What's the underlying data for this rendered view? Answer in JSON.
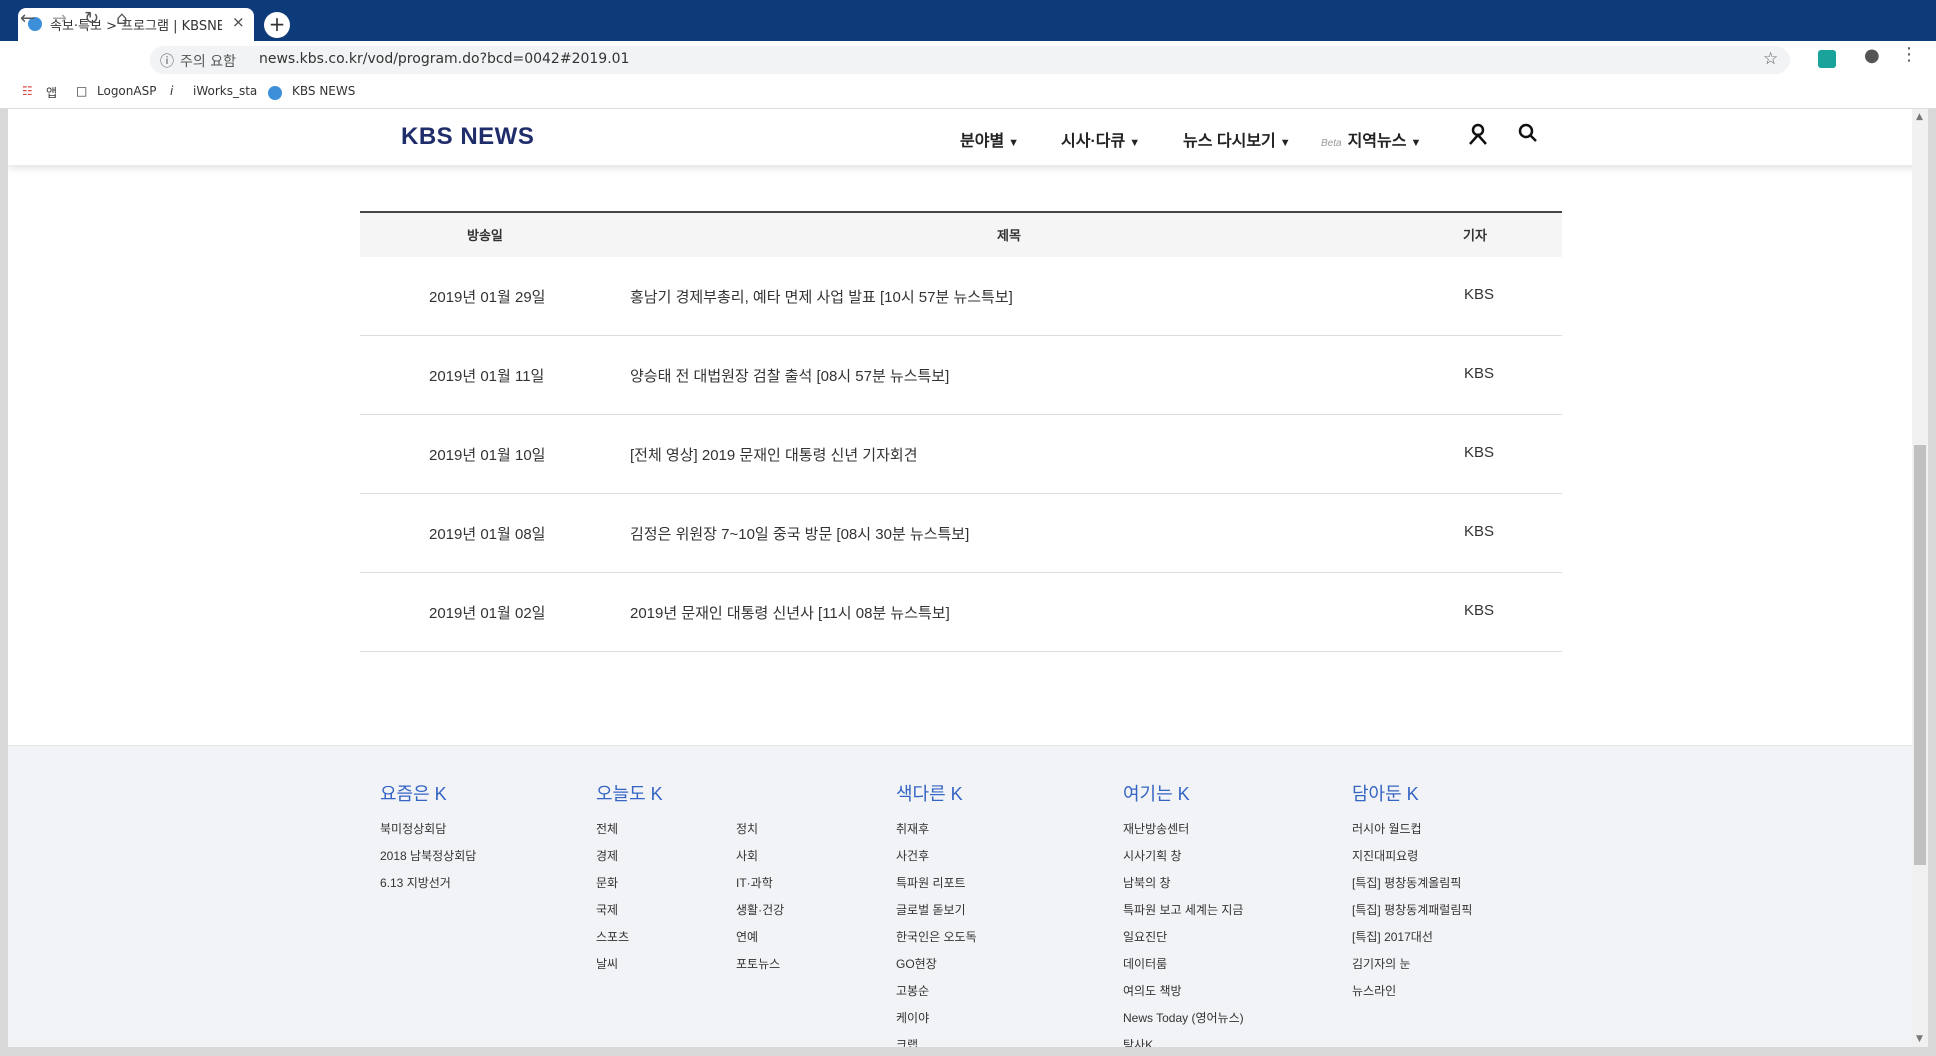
{
  "browser": {
    "tab_title": "속보·특보 > 프로그램 | KBSNEWS",
    "tab_close": "×",
    "new_tab": "+",
    "security_label": "주의 요함",
    "url": "news.kbs.co.kr/vod/program.do?bcd=0042#2019.01",
    "bookmarks": [
      "앱",
      "LogonASP",
      "iWorks_sta",
      "KBS NEWS"
    ]
  },
  "header": {
    "logo": "KBS NEWS",
    "nav": [
      {
        "label": "분야별"
      },
      {
        "label": "시사·다큐"
      },
      {
        "label": "뉴스 다시보기"
      },
      {
        "label": "지역뉴스",
        "badge": "Beta"
      }
    ]
  },
  "table": {
    "columns": [
      "방송일",
      "제목",
      "기자"
    ],
    "rows": [
      {
        "date": "2019년 01월 29일",
        "title": "홍남기 경제부총리, 예타 면제 사업 발표 [10시 57분 뉴스특보]",
        "reporter": "KBS"
      },
      {
        "date": "2019년 01월 11일",
        "title": "양승태 전 대법원장 검찰 출석 [08시 57분 뉴스특보]",
        "reporter": "KBS"
      },
      {
        "date": "2019년 01월 10일",
        "title": "[전체 영상] 2019 문재인 대통령 신년 기자회견",
        "reporter": "KBS"
      },
      {
        "date": "2019년 01월 08일",
        "title": "김정은 위원장 7~10일 중국 방문 [08시 30분 뉴스특보]",
        "reporter": "KBS"
      },
      {
        "date": "2019년 01월 02일",
        "title": "2019년 문재인 대통령 신년사 [11시 08분 뉴스특보]",
        "reporter": "KBS"
      }
    ]
  },
  "footer": {
    "sections": [
      {
        "title": "요즘은 K",
        "links": [
          "북미정상회담",
          "2018 남북정상회담",
          "6.13 지방선거"
        ]
      },
      {
        "title": "오늘도 K",
        "links": [
          "전체",
          "경제",
          "문화",
          "국제",
          "스포츠",
          "날씨"
        ],
        "links2": [
          "정치",
          "사회",
          "IT·과학",
          "생활·건강",
          "연예",
          "포토뉴스"
        ]
      },
      {
        "title": "색다른 K",
        "links": [
          "취재후",
          "사건후",
          "특파원 리포트",
          "글로벌 돋보기",
          "한국인은 오도독",
          "GO현장",
          "고봉순",
          "케이야",
          "크랩"
        ]
      },
      {
        "title": "여기는 K",
        "links": [
          "재난방송센터",
          "시사기획 창",
          "남북의 창",
          "특파원 보고 세계는 지금",
          "일요진단",
          "데이터룸",
          "여의도 책방",
          "News Today (영어뉴스)",
          "탐사K"
        ]
      },
      {
        "title": "담아둔 K",
        "links": [
          "러시아 월드컵",
          "지진대피요령",
          "[특집] 평창동계올림픽",
          "[특집] 평창동계패럴림픽",
          "[특집] 2017대선",
          "김기자의 눈",
          "뉴스라인"
        ]
      }
    ]
  }
}
